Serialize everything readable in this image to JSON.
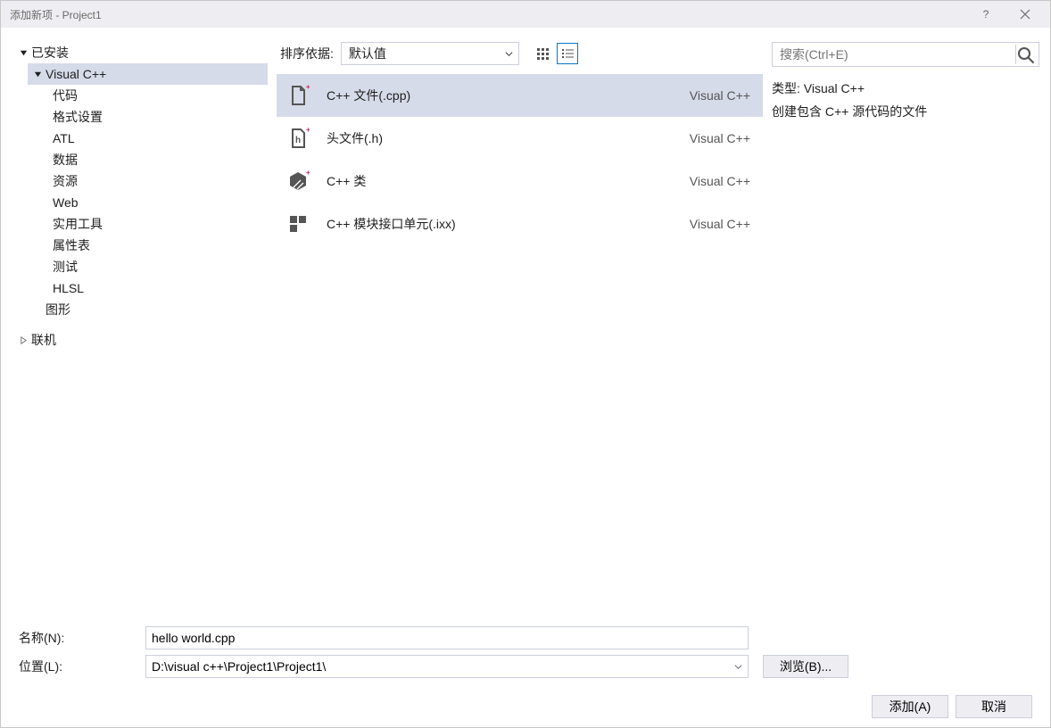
{
  "window": {
    "title": "添加新项 - Project1"
  },
  "tree": {
    "installed": "已安装",
    "vcpp": "Visual C++",
    "children": [
      "代码",
      "格式设置",
      "ATL",
      "数据",
      "资源",
      "Web",
      "实用工具",
      "属性表",
      "测试",
      "HLSL"
    ],
    "graphics": "图形",
    "online": "联机"
  },
  "toolbar": {
    "sort_label": "排序依据:",
    "sort_value": "默认值"
  },
  "templates": [
    {
      "label": "C++ 文件(.cpp)",
      "lang": "Visual C++"
    },
    {
      "label": "头文件(.h)",
      "lang": "Visual C++"
    },
    {
      "label": "C++ 类",
      "lang": "Visual C++"
    },
    {
      "label": "C++ 模块接口单元(.ixx)",
      "lang": "Visual C++"
    }
  ],
  "search": {
    "placeholder": "搜索(Ctrl+E)"
  },
  "details": {
    "type_line": "类型: Visual C++",
    "desc_line": "创建包含 C++ 源代码的文件"
  },
  "fields": {
    "name_label": "名称(N):",
    "name_value": "hello world.cpp",
    "location_label": "位置(L):",
    "location_value": "D:\\visual c++\\Project1\\Project1\\",
    "browse": "浏览(B)..."
  },
  "buttons": {
    "add": "添加(A)",
    "cancel": "取消"
  }
}
